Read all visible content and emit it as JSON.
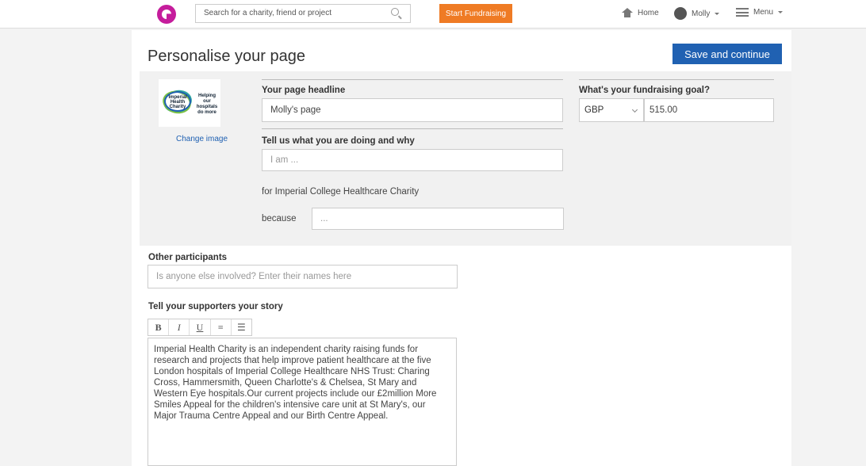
{
  "header": {
    "search_placeholder": "Search for a charity, friend or project",
    "start_fundraising": "Start Fundraising",
    "home": "Home",
    "user": "Molly",
    "menu": "Menu"
  },
  "page": {
    "title": "Personalise your page",
    "save_button": "Save and continue"
  },
  "charity": {
    "logo_name": "Imperial Health Charity",
    "logo_tagline": "Helping our hospitals do more",
    "change_image": "Change image"
  },
  "headline": {
    "label": "Your page headline",
    "value": "Molly's page"
  },
  "goal": {
    "label": "What's your fundraising goal?",
    "currency": "GBP",
    "amount": "515.00"
  },
  "why": {
    "label": "Tell us what you are doing and why",
    "i_am_placeholder": "I am ...",
    "for_text": "for Imperial College Healthcare Charity",
    "because_label": "because",
    "because_placeholder": "..."
  },
  "participants": {
    "label": "Other participants",
    "placeholder": "Is anyone else involved? Enter their names here"
  },
  "story": {
    "label": "Tell your supporters your story",
    "toolbar": [
      "B",
      "I",
      "U",
      "≡",
      "☰"
    ],
    "text": "Imperial Health Charity is an independent charity raising funds for research and projects that help improve patient healthcare at the five London hospitals of Imperial College Healthcare NHS Trust: Charing Cross, Hammersmith, Queen Charlotte's & Chelsea, St Mary and Western Eye hospitals.Our current projects include our £2million More Smiles Appeal for the children's intensive care unit at St Mary's, our Major Trauma Centre Appeal and our Birth Centre Appeal."
  },
  "colors": {
    "brand": "#c51d9c",
    "accent": "#ef7b24",
    "primary": "#2061b2"
  }
}
